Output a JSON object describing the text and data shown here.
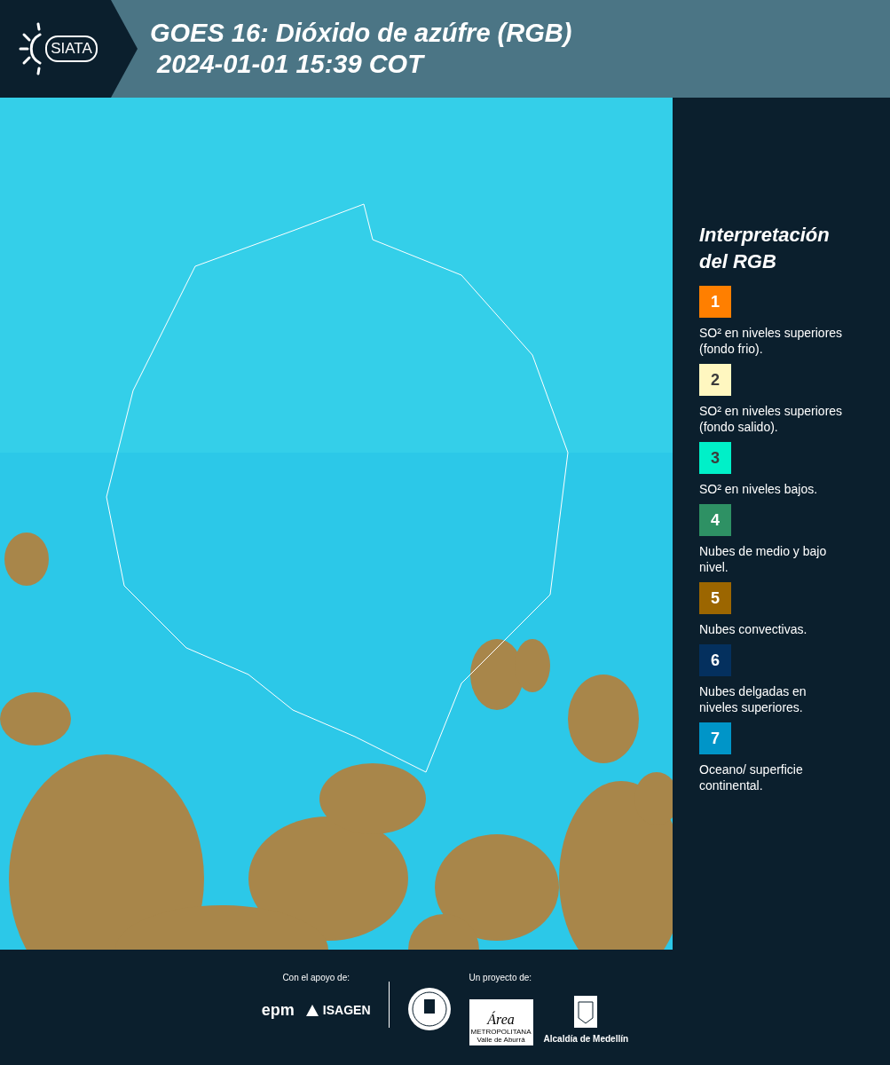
{
  "header": {
    "logo_text": "SIATA",
    "title": "GOES 16: Dióxido de azúfre (RGB)",
    "timestamp": "2024-01-01 15:39 COT"
  },
  "legend": {
    "title": "Interpretación del RGB",
    "items": [
      {
        "number": "1",
        "color": "#ff7f00",
        "text": "SO² en niveles superiores (fondo frio)."
      },
      {
        "number": "2",
        "color": "#fff7c0",
        "text": "SO² en niveles superiores (fondo salido)."
      },
      {
        "number": "3",
        "color": "#00f0c8",
        "text": "SO² en niveles bajos."
      },
      {
        "number": "4",
        "color": "#2e9164",
        "text": "Nubes de medio y bajo nivel."
      },
      {
        "number": "5",
        "color": "#9c6600",
        "text": "Nubes convectivas."
      },
      {
        "number": "6",
        "color": "#04305e",
        "text": "Nubes delgadas en niveles superiores."
      },
      {
        "number": "7",
        "color": "#0095c8",
        "text": "Oceano/ superficie continental."
      }
    ]
  },
  "footer": {
    "support_label": "Con el apoyo de:",
    "project_label": "Un proyecto de:",
    "epm": "epm",
    "isagen": "ISAGEN",
    "area_script": "Área",
    "area_name": "METROPOLITANA",
    "area_sub": "Valle de Aburrá",
    "alcaldia": "Alcaldía de Medellín"
  }
}
